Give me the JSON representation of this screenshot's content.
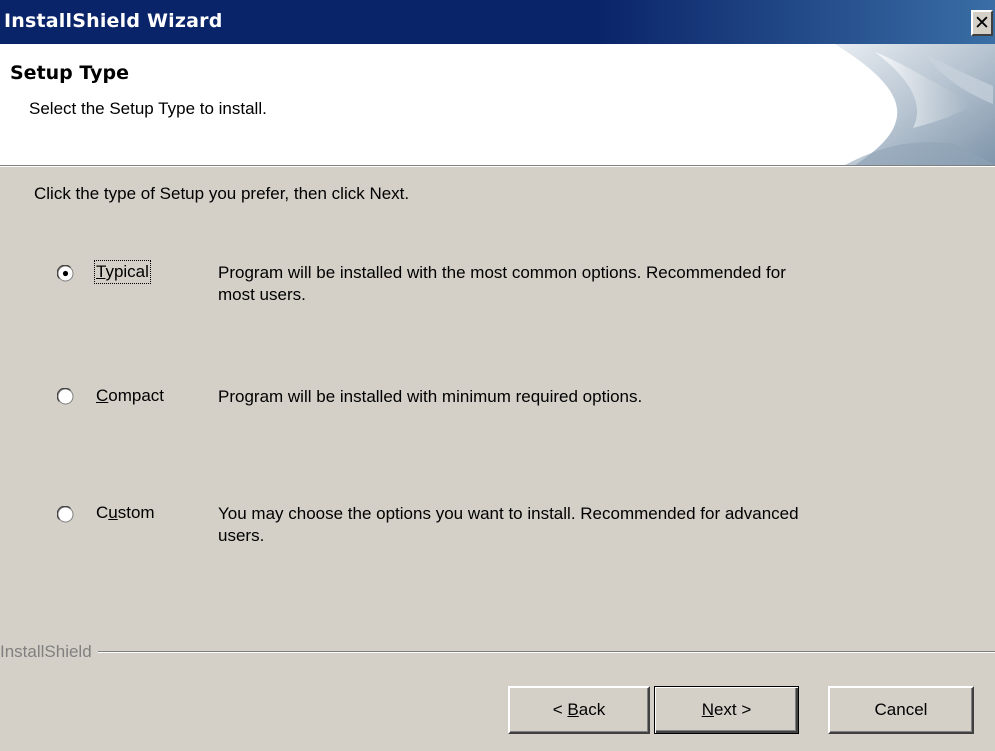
{
  "window": {
    "title": "InstallShield Wizard",
    "close_glyph": "✕",
    "close_icon": "close-icon"
  },
  "header": {
    "title": "Setup Type",
    "subtitle": "Select the Setup Type to install.",
    "art_icon": "wizard-header-art"
  },
  "instruction": "Click the type of Setup you prefer, then click Next.",
  "options": [
    {
      "label_pre": "",
      "label_mnemonic": "T",
      "label_post": "ypical",
      "description_line1": "Program will be installed with the most common options.  Recommended for",
      "description_line2": "most users.",
      "selected": true
    },
    {
      "label_pre": "",
      "label_mnemonic": "C",
      "label_post": "ompact",
      "description_line1": "Program will be installed with minimum required options.",
      "description_line2": "",
      "selected": false
    },
    {
      "label_pre": "C",
      "label_mnemonic": "u",
      "label_post": "stom",
      "description_line1": "You may choose the options you want to install. Recommended for advanced",
      "description_line2": "users.",
      "selected": false
    }
  ],
  "footer": {
    "brand": "InstallShield",
    "back": {
      "pre": "< ",
      "mnemonic": "B",
      "post": "ack"
    },
    "next": {
      "pre": "",
      "mnemonic": "N",
      "post": "ext >"
    },
    "cancel": "Cancel"
  }
}
